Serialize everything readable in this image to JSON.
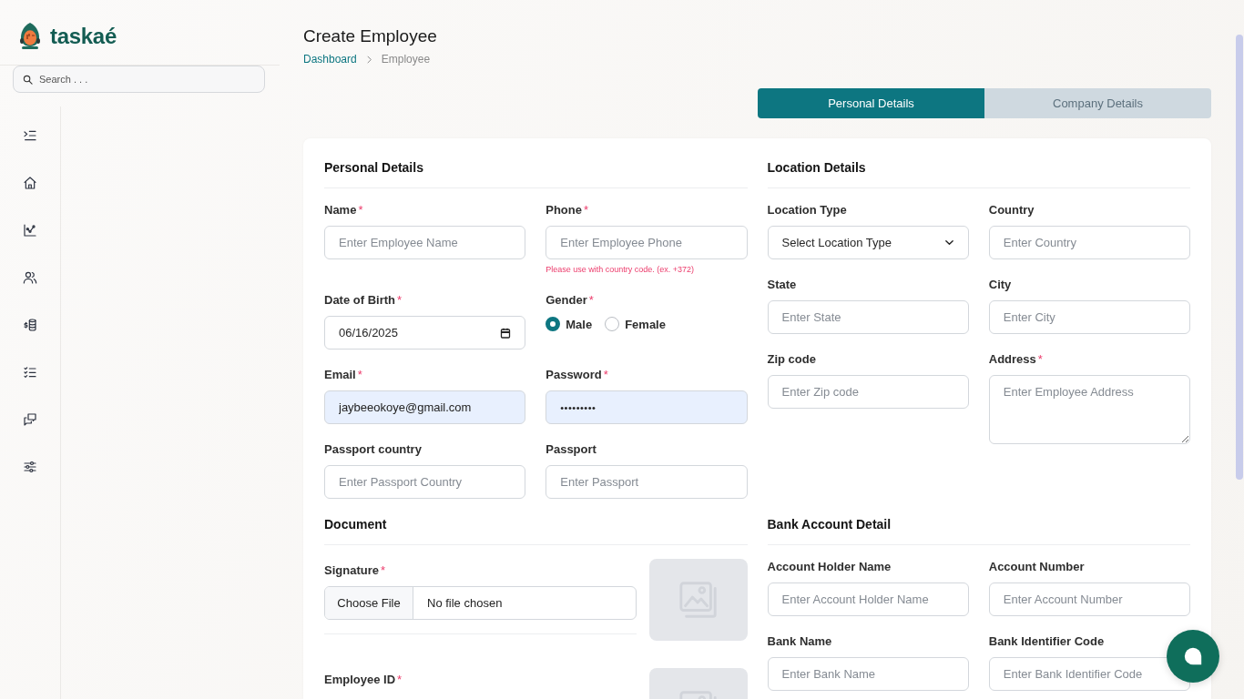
{
  "sidebar": {
    "logo": "taskaé",
    "search": {
      "placeholder": "Search . . ."
    }
  },
  "header": {
    "title": "Create Employee",
    "breadcrumb": [
      {
        "label": "Dashboard",
        "kind": "link"
      },
      {
        "label": "Employee",
        "kind": "current"
      }
    ]
  },
  "tabs": [
    {
      "label": "Personal Details",
      "selected": true
    },
    {
      "label": "Company Details",
      "selected": false
    }
  ],
  "form": {
    "sections": [
      {
        "title": "Personal Details",
        "kind": "fields",
        "fields": [
          {
            "label": "Name",
            "required_mark": "*",
            "kind": "text",
            "placeholder": "Enter Employee Name",
            "autofilled": false
          },
          {
            "label": "Phone",
            "required_mark": "*",
            "kind": "text",
            "placeholder": "Enter Employee Phone",
            "hint": "Please use with country code. (ex. +372)",
            "autofilled": false
          },
          {
            "label": "Date of Birth",
            "required_mark": "*",
            "kind": "date",
            "value": "06/16/2025",
            "autofilled": false
          },
          {
            "label": "Gender",
            "required_mark": "*",
            "kind": "radio",
            "options": [
              {
                "label": "Male",
                "selected": true
              },
              {
                "label": "Female",
                "selected": false
              }
            ]
          },
          {
            "label": "Email",
            "required_mark": "*",
            "kind": "text",
            "value": "jaybeeokoye@gmail.com",
            "autofilled": true
          },
          {
            "label": "Password",
            "required_mark": "*",
            "kind": "password",
            "value": "•••••••••",
            "autofilled": true
          },
          {
            "label": "Passport country",
            "kind": "text",
            "placeholder": "Enter Passport Country",
            "autofilled": false
          },
          {
            "label": "Passport",
            "kind": "text",
            "placeholder": "Enter Passport",
            "autofilled": false
          }
        ]
      },
      {
        "title": "Location Details",
        "kind": "fields",
        "fields": [
          {
            "label": "Location Type",
            "kind": "select",
            "value": "Select Location Type",
            "autofilled": false
          },
          {
            "label": "Country",
            "kind": "text",
            "placeholder": "Enter Country",
            "autofilled": false
          },
          {
            "label": "State",
            "kind": "text",
            "placeholder": "Enter State",
            "autofilled": false
          },
          {
            "label": "City",
            "kind": "text",
            "placeholder": "Enter City",
            "autofilled": false
          },
          {
            "label": "Zip code",
            "kind": "text",
            "placeholder": "Enter Zip code",
            "autofilled": false
          },
          {
            "label": "Address",
            "required_mark": "*",
            "kind": "textarea",
            "placeholder": "Enter Employee Address",
            "autofilled": false
          }
        ]
      },
      {
        "title": "Document",
        "kind": "documents",
        "items": [
          {
            "label": "Signature",
            "required_mark": "*",
            "button": "Choose File",
            "status": "No file chosen"
          },
          {
            "label": "Employee ID",
            "required_mark": "*"
          }
        ]
      },
      {
        "title": "Bank Account Detail",
        "kind": "fields",
        "fields": [
          {
            "label": "Account Holder Name",
            "kind": "text",
            "placeholder": "Enter Account Holder Name",
            "autofilled": false
          },
          {
            "label": "Account Number",
            "kind": "text",
            "placeholder": "Enter Account Number",
            "autofilled": false
          },
          {
            "label": "Bank Name",
            "kind": "text",
            "placeholder": "Enter Bank Name",
            "autofilled": false
          },
          {
            "label": "Bank Identifier Code",
            "kind": "text",
            "placeholder": "Enter Bank Identifier Code",
            "autofilled": false
          }
        ]
      }
    ]
  }
}
